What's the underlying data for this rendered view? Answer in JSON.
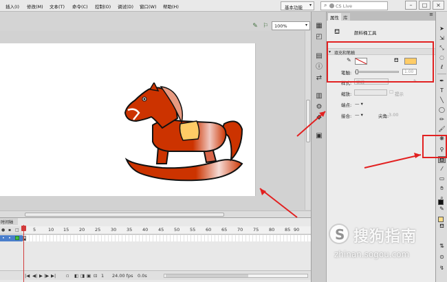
{
  "menu": {
    "items": [
      "插入(I)",
      "修改(M)",
      "文本(T)",
      "命令(C)",
      "控制(O)",
      "调试(D)",
      "窗口(W)",
      "帮助(H)"
    ],
    "workspace_label": "基本功能",
    "search_label": "CS Live"
  },
  "stage": {
    "zoom": "100%",
    "horse_colors": {
      "body": "#cc3300",
      "saddle": "#ffcc66",
      "outline": "#111111"
    }
  },
  "timeline": {
    "tab_label": "时间轴",
    "frame_labels": [
      "5",
      "10",
      "15",
      "20",
      "25",
      "30",
      "35",
      "40",
      "45",
      "50",
      "55",
      "60",
      "65",
      "70",
      "75",
      "80",
      "85",
      "90"
    ],
    "current_frame": "1",
    "fps": "24.00 fps",
    "time": "0.0s",
    "layer_icons": [
      "eye-icon",
      "lock-icon",
      "outline-icon"
    ]
  },
  "props": {
    "tabs": [
      "属性",
      "库"
    ],
    "tool_name": "颜料桶工具",
    "section_title": "填充和笔触",
    "stroke_label": "笔触:",
    "stroke_value": "1.00",
    "style_label": "样式:",
    "style_value": "实线",
    "scale_label": "缩放:",
    "hint_label": "提示",
    "endpoint_label": "端点:",
    "join_label": "接合:",
    "miter_label": "尖角:",
    "miter_value": "3.00",
    "fill_color": "#ffcc66",
    "stroke_color": "#d94040",
    "accent": "#e22020"
  },
  "tools": {
    "stroke_color": "#111111",
    "fill_color": "#ffdd88",
    "selected_tool": "paint-bucket-icon"
  },
  "watermark": {
    "cn": "搜狗指南",
    "url": "zhinan.sogou.com"
  }
}
